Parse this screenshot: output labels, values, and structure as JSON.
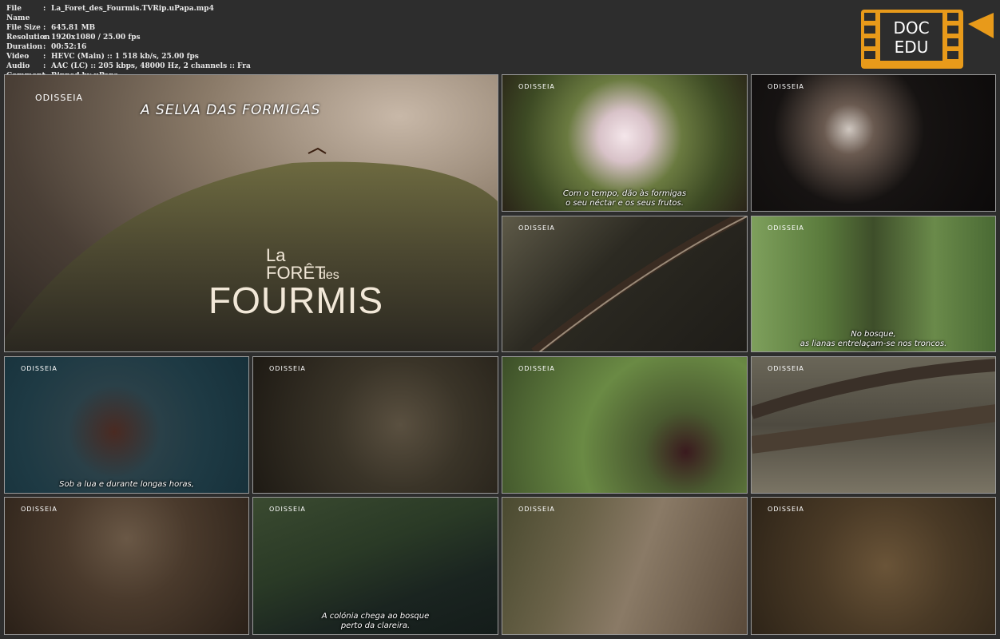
{
  "meta": [
    {
      "key": "File Name",
      "value": "La_Foret_des_Fourmis.TVRip.uPapa.mp4"
    },
    {
      "key": "File Size",
      "value": "645.81 MB"
    },
    {
      "key": "Resolution",
      "value": "1920x1080 / 25.00 fps"
    },
    {
      "key": "Duration",
      "value": "00:52:16"
    },
    {
      "key": "Video",
      "value": "HEVC (Main) :: 1 518 kb/s, 25.00 fps"
    },
    {
      "key": "Audio",
      "value": "AAC (LC) :: 205 kbps, 48000 Hz, 2 channels :: Fra"
    },
    {
      "key": "Comment",
      "value": "Ripped by uPapa"
    }
  ],
  "logo": {
    "line1": "DOC",
    "line2": "EDU",
    "color": "#e89a1a"
  },
  "brand": "ODISSEIA",
  "main": {
    "headline": "A SELVA DAS FORMIGAS",
    "title_la": "La",
    "title_foret": "FORÊT",
    "title_des": "des",
    "title_fourmis": "FOURMIS"
  },
  "subtitles": {
    "t2": "Com o tempo, dão às formigas\no seu néctar e os seus frutos.",
    "t5": "No bosque,\nas lianas entrelaçam-se nos troncos.",
    "t6": "Sob a lua e durante longas horas,",
    "t14": "A colónia chega ao bosque\nperto da clareira."
  }
}
